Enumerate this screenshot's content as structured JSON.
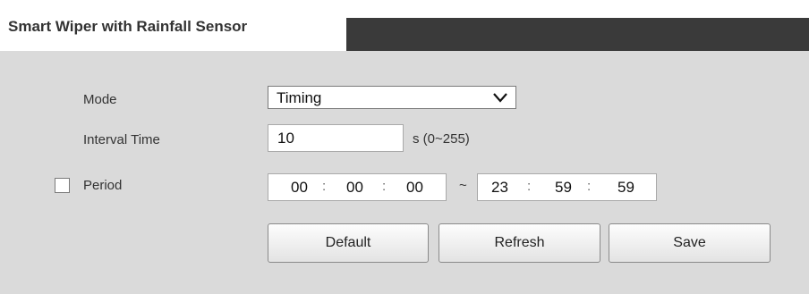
{
  "header": {
    "title": "Smart Wiper with Rainfall Sensor"
  },
  "form": {
    "mode": {
      "label": "Mode",
      "value": "Timing"
    },
    "interval": {
      "label": "Interval Time",
      "value": "10",
      "unit": "s (0~255)"
    },
    "period": {
      "label": "Period",
      "checked": false,
      "start": {
        "hh": "00",
        "mm": "00",
        "ss": "00"
      },
      "end": {
        "hh": "23",
        "mm": "59",
        "ss": "59"
      },
      "range_separator": "~",
      "time_separator": ":"
    }
  },
  "buttons": {
    "default": "Default",
    "refresh": "Refresh",
    "save": "Save"
  },
  "colors": {
    "panel_bg": "#dadada",
    "header_dark": "#3a3a3a",
    "text": "#333333"
  }
}
